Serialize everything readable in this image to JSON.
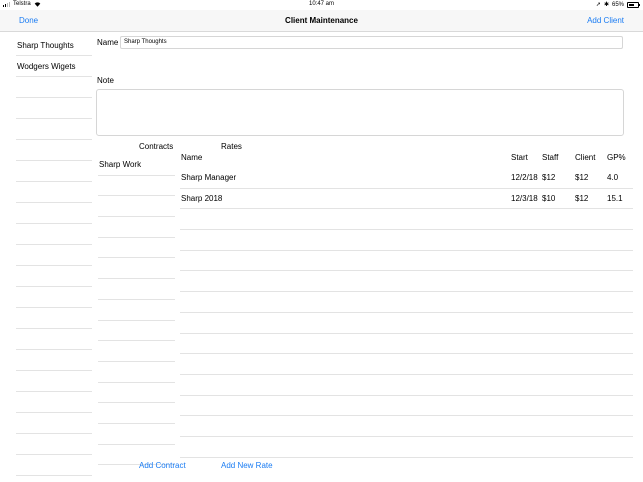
{
  "status_bar": {
    "carrier": "Telstra",
    "time": "10:47 am",
    "battery": "65%",
    "battery_level": 0.65,
    "icons": [
      "signal-icon",
      "wifi-icon",
      "location-icon",
      "bluetooth-icon",
      "battery-icon"
    ]
  },
  "navbar": {
    "done_label": "Done",
    "title": "Client Maintenance",
    "add_client_label": "Add Client"
  },
  "clients": [
    "Sharp Thoughts",
    "Wodgers Wigets",
    "",
    "",
    "",
    "",
    "",
    "",
    "",
    "",
    "",
    "",
    "",
    "",
    "",
    "",
    "",
    "",
    "",
    "",
    ""
  ],
  "form": {
    "name_label": "Name",
    "name_value": "Sharp Thoughts",
    "note_label": "Note",
    "note_value": ""
  },
  "contracts": {
    "header": "Contracts",
    "items": [
      "Sharp Work",
      "",
      "",
      "",
      "",
      "",
      "",
      "",
      "",
      "",
      "",
      "",
      "",
      "",
      ""
    ],
    "add_label": "Add Contract"
  },
  "rates": {
    "header": "Rates",
    "columns": {
      "name": "Name",
      "start": "Start",
      "staff": "Staff",
      "client": "Client",
      "gp": "GP%"
    },
    "rows": [
      {
        "name": "Sharp Manager",
        "start": "12/2/18",
        "staff": "$12",
        "client": "$12",
        "gp": "4.0"
      },
      {
        "name": "Sharp 2018",
        "start": "12/3/18",
        "staff": "$10",
        "client": "$12",
        "gp": "15.1"
      },
      {
        "name": "",
        "start": "",
        "staff": "",
        "client": "",
        "gp": ""
      },
      {
        "name": "",
        "start": "",
        "staff": "",
        "client": "",
        "gp": ""
      },
      {
        "name": "",
        "start": "",
        "staff": "",
        "client": "",
        "gp": ""
      },
      {
        "name": "",
        "start": "",
        "staff": "",
        "client": "",
        "gp": ""
      },
      {
        "name": "",
        "start": "",
        "staff": "",
        "client": "",
        "gp": ""
      },
      {
        "name": "",
        "start": "",
        "staff": "",
        "client": "",
        "gp": ""
      },
      {
        "name": "",
        "start": "",
        "staff": "",
        "client": "",
        "gp": ""
      },
      {
        "name": "",
        "start": "",
        "staff": "",
        "client": "",
        "gp": ""
      },
      {
        "name": "",
        "start": "",
        "staff": "",
        "client": "",
        "gp": ""
      },
      {
        "name": "",
        "start": "",
        "staff": "",
        "client": "",
        "gp": ""
      },
      {
        "name": "",
        "start": "",
        "staff": "",
        "client": "",
        "gp": ""
      },
      {
        "name": "",
        "start": "",
        "staff": "",
        "client": "",
        "gp": ""
      }
    ],
    "add_label": "Add New Rate"
  },
  "colors": {
    "accent": "#1a7cf3",
    "separator": "#e3e3e3",
    "navbar_bg": "#f7f7f7"
  }
}
